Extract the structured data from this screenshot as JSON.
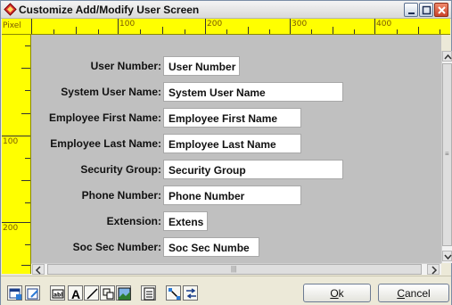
{
  "window": {
    "title": "Customize Add/Modify User Screen"
  },
  "ruler": {
    "unit_label": "Pixel",
    "h_labels": [
      "100",
      "200",
      "300",
      "400"
    ],
    "v_labels": [
      "100",
      "200"
    ]
  },
  "form": {
    "rows": [
      {
        "label": "User Number:",
        "value": "User Number"
      },
      {
        "label": "System User Name:",
        "value": "System User Name"
      },
      {
        "label": "Employee First Name:",
        "value": "Employee First Name"
      },
      {
        "label": "Employee Last Name:",
        "value": "Employee Last Name"
      },
      {
        "label": "Security Group:",
        "value": "Security Group"
      },
      {
        "label": "Phone Number:",
        "value": "Phone Number"
      },
      {
        "label": "Extension:",
        "value": "Extens"
      },
      {
        "label": "Soc Sec Number:",
        "value": "Soc Sec Numbe"
      }
    ]
  },
  "buttons": {
    "ok_accel": "O",
    "ok_rest": "k",
    "cancel_accel": "C",
    "cancel_rest": "ancel"
  },
  "colors": {
    "ruler": "#ffff00",
    "canvas": "#c0c0c0",
    "field": "#ffffff"
  }
}
